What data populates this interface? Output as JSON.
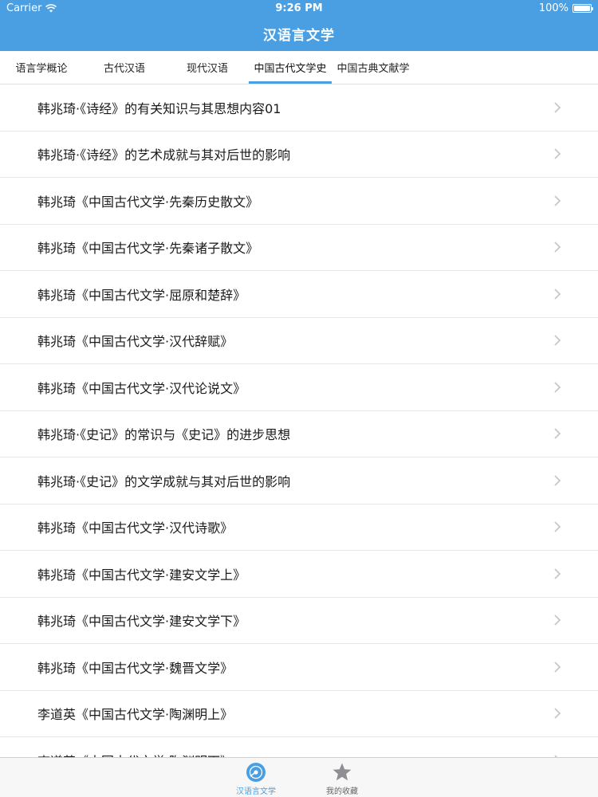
{
  "status_bar": {
    "carrier": "Carrier",
    "time": "9:26 PM",
    "battery": "100%",
    "battery_level": 1.0
  },
  "nav": {
    "title": "汉语言文学"
  },
  "tabs": [
    {
      "label": "语言学概论",
      "active": false
    },
    {
      "label": "古代汉语",
      "active": false
    },
    {
      "label": "现代汉语",
      "active": false
    },
    {
      "label": "中国古代文学史",
      "active": true
    },
    {
      "label": "中国古典文献学",
      "active": false
    }
  ],
  "list": {
    "items": [
      "韩兆琦·《诗经》的有关知识与其思想内容01",
      "韩兆琦·《诗经》的艺术成就与其对后世的影响",
      "韩兆琦《中国古代文学·先秦历史散文》",
      "韩兆琦《中国古代文学·先秦诸子散文》",
      "韩兆琦《中国古代文学·屈原和楚辞》",
      "韩兆琦《中国古代文学·汉代辞赋》",
      "韩兆琦《中国古代文学·汉代论说文》",
      "韩兆琦·《史记》的常识与《史记》的进步思想",
      "韩兆琦·《史记》的文学成就与其对后世的影响",
      "韩兆琦《中国古代文学·汉代诗歌》",
      "韩兆琦《中国古代文学·建安文学上》",
      "韩兆琦《中国古代文学·建安文学下》",
      "韩兆琦《中国古代文学·魏晋文学》",
      "李道英《中国古代文学·陶渊明上》",
      "李道英《中国古代文学·陶渊明下》"
    ],
    "chevron_icon": "chevron-right-icon"
  },
  "tab_bar": {
    "items": [
      {
        "label": "汉语言文学",
        "icon": "disc-icon",
        "active": true
      },
      {
        "label": "我的收藏",
        "icon": "star-icon",
        "active": false
      }
    ]
  },
  "colors": {
    "accent": "#4a9fe3",
    "chevron": "#c7c7cc"
  }
}
